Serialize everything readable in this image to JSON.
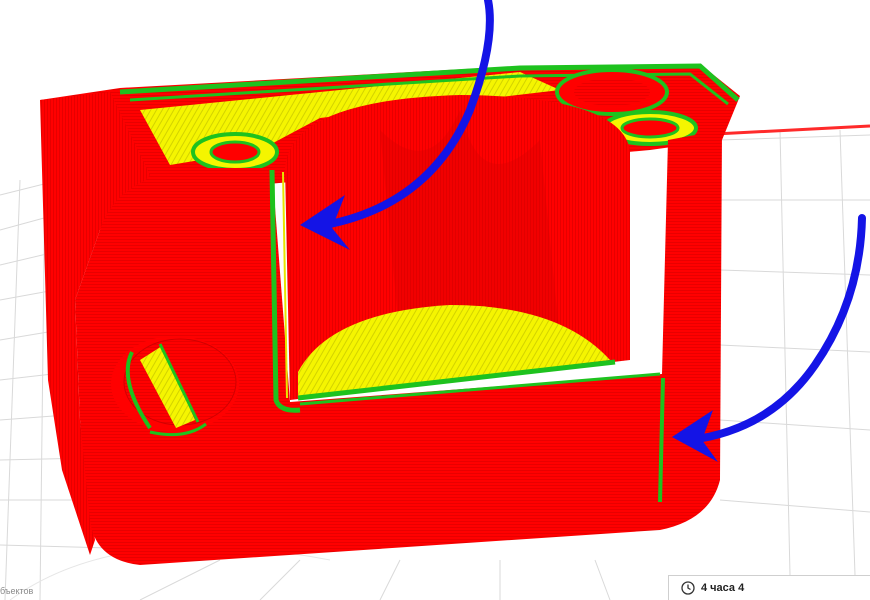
{
  "status": {
    "objects_label": "бъектов"
  },
  "print_time": {
    "label": "4 часа 4",
    "icon": "clock-icon"
  },
  "colors": {
    "model_red": "#ff0000",
    "infill_yellow": "#f2f200",
    "wall_green": "#1ec21e",
    "annotation_blue": "#1414e6",
    "axis_red": "#ff2a2a",
    "grid": "#c8c8c8"
  },
  "annotations": [
    {
      "name": "arrow-inner-seam",
      "color": "#1414e6"
    },
    {
      "name": "arrow-outer-seam",
      "color": "#1414e6"
    }
  ]
}
